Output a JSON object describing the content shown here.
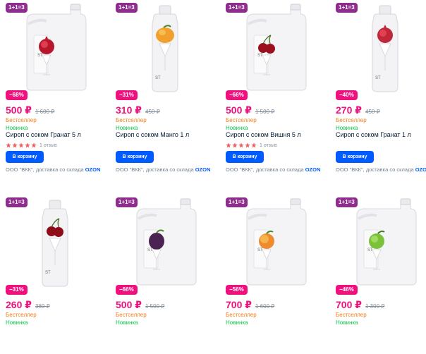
{
  "cart_label": "В корзину",
  "seller_text": "ООО \"ВКК\", доставка со склада",
  "ozon": "OZON",
  "edge_glyph": "с",
  "products": [
    {
      "promo": "1+1=3",
      "discount": "−68%",
      "price": "500 ₽",
      "old": "1 600 ₽",
      "best": "Бестселлер",
      "new": "Новинка",
      "title": "Сироп с соком Гранат 5 л",
      "reviews": "1 отзыв",
      "fruit": "pomegranate",
      "container": "canister",
      "fruit_color": "#b8162c"
    },
    {
      "promo": "1+1=3",
      "discount": "−31%",
      "price": "310 ₽",
      "old": "450 ₽",
      "best": "Бестселлер",
      "new": "Новинка",
      "title": "Сироп с соком Манго 1 л",
      "reviews": "",
      "fruit": "mango",
      "container": "bottle",
      "fruit_color": "#f2a02d"
    },
    {
      "promo": "1+1=3",
      "discount": "−66%",
      "price": "500 ₽",
      "old": "1 500 ₽",
      "best": "Бестселлер",
      "new": "Новинка",
      "title": "Сироп с соком Вишня 5 л",
      "reviews": "1 отзыв",
      "fruit": "cherry",
      "container": "canister",
      "fruit_color": "#9b0f1e"
    },
    {
      "promo": "1+1=3",
      "discount": "−40%",
      "price": "270 ₽",
      "old": "450 ₽",
      "best": "Бестселлер",
      "new": "Новинка",
      "title": "Сироп с соком Гранат 1 л",
      "reviews": "",
      "fruit": "pomegranate",
      "container": "bottle",
      "fruit_color": "#c0283a"
    },
    {
      "promo": "1+1=3",
      "discount": "−31%",
      "price": "260 ₽",
      "old": "380 ₽",
      "best": "Бестселлер",
      "new": "Новинка",
      "title": "",
      "reviews": "",
      "fruit": "cherry",
      "container": "bottle",
      "fruit_color": "#8e0b18"
    },
    {
      "promo": "1+1=3",
      "discount": "−66%",
      "price": "500 ₽",
      "old": "1 500 ₽",
      "best": "Бестселлер",
      "new": "Новинка",
      "title": "",
      "reviews": "",
      "fruit": "plum",
      "container": "canister",
      "fruit_color": "#4a2352"
    },
    {
      "promo": "1+1=3",
      "discount": "−56%",
      "price": "700 ₽",
      "old": "1 600 ₽",
      "best": "Бестселлер",
      "new": "Новинка",
      "title": "",
      "reviews": "",
      "fruit": "peach",
      "container": "canister",
      "fruit_color": "#f08a2e"
    },
    {
      "promo": "1+1=3",
      "discount": "−46%",
      "price": "700 ₽",
      "old": "1 300 ₽",
      "best": "Бестселлер",
      "new": "Новинка",
      "title": "",
      "reviews": "",
      "fruit": "lime",
      "container": "canister",
      "fruit_color": "#79c23a"
    }
  ]
}
